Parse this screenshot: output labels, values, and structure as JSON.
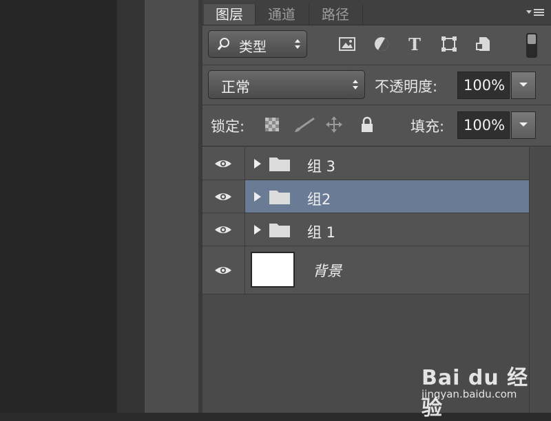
{
  "tabs": [
    {
      "label": "图层",
      "active": true
    },
    {
      "label": "通道",
      "active": false
    },
    {
      "label": "路径",
      "active": false
    }
  ],
  "filter": {
    "kind_label": "类型"
  },
  "blend": {
    "mode_label": "正常",
    "opacity_label": "不透明度:",
    "opacity_value": "100%"
  },
  "lock": {
    "label": "锁定:",
    "fill_label": "填充:",
    "fill_value": "100%"
  },
  "layers": [
    {
      "name": "组 3",
      "type": "group",
      "visible": true,
      "selected": false
    },
    {
      "name": "组2",
      "type": "group",
      "visible": true,
      "selected": false
    },
    {
      "name": "组 1",
      "type": "group",
      "visible": true,
      "selected": false
    },
    {
      "name": "背景",
      "type": "background",
      "visible": true,
      "locked": true
    }
  ],
  "colors": {
    "selected_row": "#6a7b95",
    "panel": "#535353",
    "tabbar": "#404040"
  },
  "watermark": {
    "brand": "Bai du 经验",
    "url": "jingyan.baidu.com"
  }
}
